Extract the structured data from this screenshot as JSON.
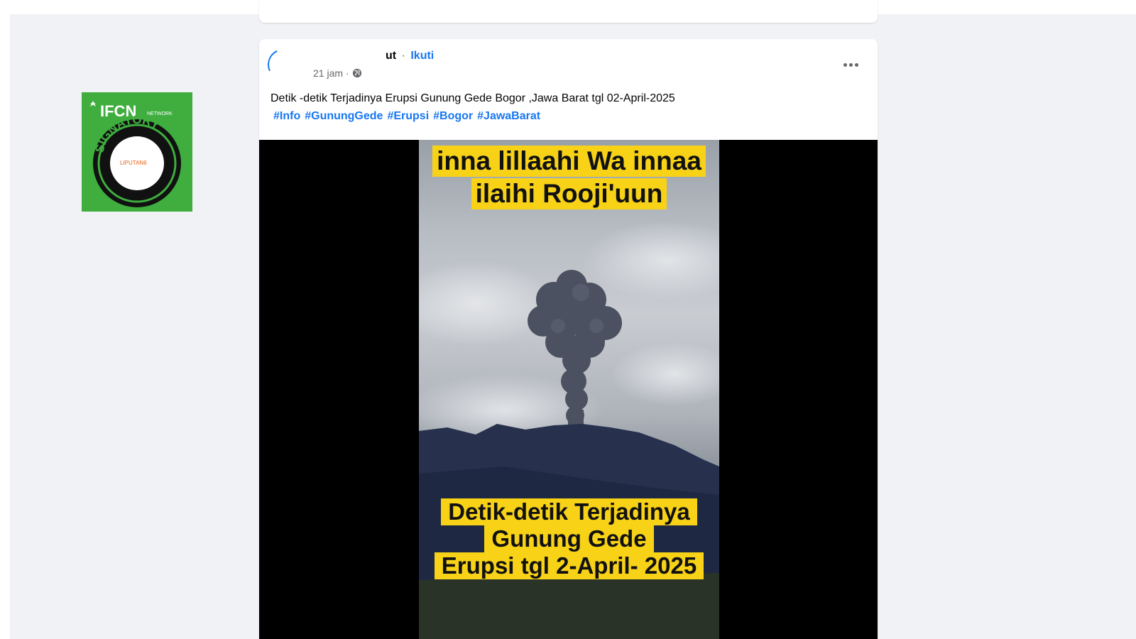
{
  "post": {
    "author_visible_fragment": "ut",
    "separator": "·",
    "follow_label": "Ikuti",
    "timestamp": "21 jam",
    "meta_separator": "·",
    "caption": "Detik -detik Terjadinya Erupsi Gunung Gede Bogor ,Jawa Barat tgl 02-April-2025",
    "hashtags": [
      "#Info",
      "#GunungGede",
      "#Erupsi",
      "#Bogor",
      "#JawaBarat"
    ]
  },
  "video": {
    "overlay_top": [
      "inna lillaahi Wa innaa",
      "ilaihi Rooji'uun"
    ],
    "overlay_bottom": [
      "Detik-detik Terjadinya",
      "Gunung Gede",
      "Erupsi tgl 2-April- 2025"
    ],
    "caption_bg_color": "#f7d217"
  },
  "badge": {
    "colors": {
      "green": "#3fae3f",
      "dark": "#111111"
    }
  },
  "icons": {
    "more": "more-horizontal-icon",
    "privacy": "globe-icon"
  }
}
